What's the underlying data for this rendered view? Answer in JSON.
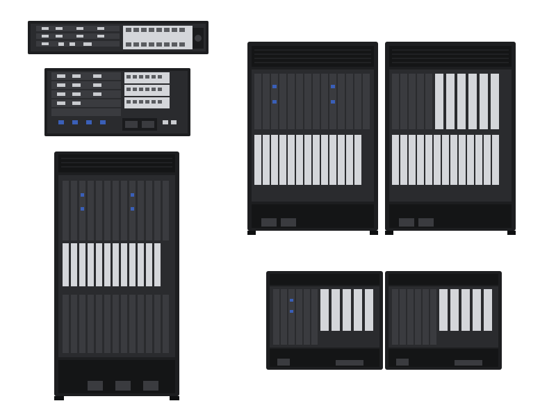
{
  "scene": {
    "background": "#ffffff"
  },
  "colors": {
    "chassis": "#1d1e20",
    "chassis_dark": "#0f1011",
    "panel": "#2a2b2e",
    "bezel": "#3a3b3f",
    "port_silver": "#c9cbcf",
    "port_white": "#e8e9eb",
    "accent_blue": "#3a5fb8",
    "accent_orange": "#d4641e",
    "vent": "#141516"
  },
  "devices": [
    {
      "label": "",
      "kind": "rack-1u"
    },
    {
      "label": "",
      "kind": "rack-4u"
    },
    {
      "label": "",
      "kind": "tower-large"
    },
    {
      "label": "",
      "kind": "chassis-medium"
    },
    {
      "label": "",
      "kind": "chassis-medium"
    },
    {
      "label": "",
      "kind": "chassis-small"
    },
    {
      "label": "",
      "kind": "chassis-small"
    }
  ]
}
